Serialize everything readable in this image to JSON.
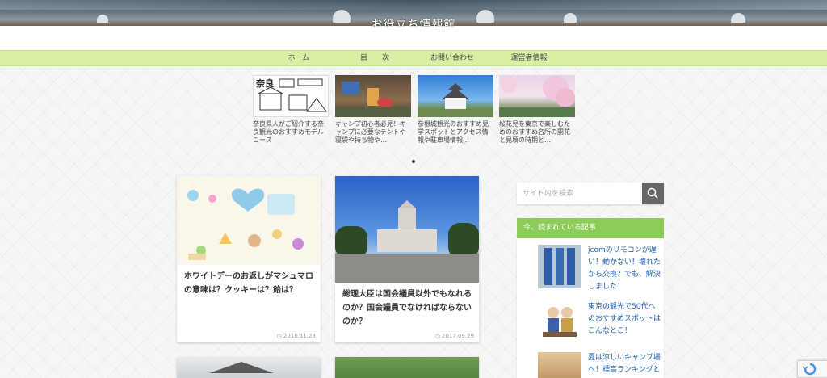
{
  "site": {
    "title": "お役立ち情報館"
  },
  "nav": {
    "items": [
      "ホーム",
      "目　　次",
      "お問い合わせ",
      "運営者情報"
    ]
  },
  "carousel": [
    {
      "caption": "奈良県人がご紹介する奈良観光のおすすめモデルコース"
    },
    {
      "caption": "キャンプ初心者必見！キャンプに必要なテントや寝袋や持ち物や…"
    },
    {
      "caption": "彦根城観光のおすすめ見学スポットとアクセス情報や駐車場情報…"
    },
    {
      "caption": "桜花見を東京で楽しむためのおすすめ名所の開花と見頃の時期と…"
    }
  ],
  "cards": [
    {
      "title": "ホワイトデーのお返しがマシュマロの意味は？クッキーは？飴は？",
      "date": "2016.11.28"
    },
    {
      "title": "総理大臣は国会議員以外でもなれるのか？国会議員でなければならないのか？",
      "date": "2017.09.29"
    }
  ],
  "sidebar": {
    "search_placeholder": "サイト内を検索",
    "widget_title": "今、読まれている記事",
    "popular": [
      {
        "title": "jcomのリモコンが遅い！動かない！壊れたから交換？でも、解決しました！"
      },
      {
        "title": "東京の観光で50代へのおすすめスポットはこんなとこ！"
      },
      {
        "title": "夏は涼しいキャンプ場へ！標高ランキングと"
      }
    ]
  },
  "colors": {
    "nav_bg": "#d9efa6",
    "widget_head": "#8ccd5a",
    "link": "#1a5fb4"
  },
  "icons": {
    "search_button": "magnifier-icon",
    "date": "clock-icon"
  }
}
